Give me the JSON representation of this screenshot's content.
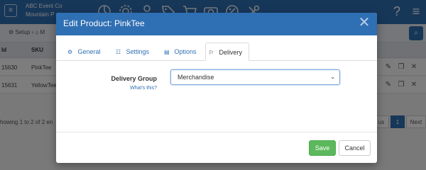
{
  "app": {
    "company_name": "ABC Event Co",
    "company_sub": "Mountain P",
    "logo_text": "≡",
    "nav_icons": [
      "analytics-icon",
      "gear-icon",
      "user-icon",
      "tags-icon",
      "cart-icon",
      "camera-icon",
      "percent-icon",
      "tools-icon"
    ],
    "help_glyph": "?",
    "menu_glyph": "≡"
  },
  "breadcrumb": {
    "setup": "⚙ Setup",
    "sep": "›",
    "next": "⌂ M"
  },
  "table": {
    "headers": {
      "id": "Id",
      "sku": "SKU"
    },
    "rows": [
      {
        "id": "15630",
        "sku": "PinkTee"
      },
      {
        "id": "15631",
        "sku": "YellowTee"
      }
    ]
  },
  "footer": {
    "showing": "howing 1 to 2 of 2 en",
    "prev": "us",
    "page": "1",
    "next": "Next"
  },
  "modal": {
    "title": "Edit Product: PinkTee",
    "close_glyph": "✕",
    "tabs": [
      {
        "label": "General",
        "icon": "⚙"
      },
      {
        "label": "Settings",
        "icon": "☷"
      },
      {
        "label": "Options",
        "icon": "▤"
      },
      {
        "label": "Delivery",
        "icon": "⚐"
      }
    ],
    "active_tab": "Delivery",
    "delivery_group_label": "Delivery Group",
    "whats_this": "What's this?",
    "delivery_group_value": "Merchandise",
    "caret": "⌄",
    "save_label": "Save",
    "cancel_label": "Cancel"
  },
  "colors": {
    "primary": "#2f6fb3",
    "save": "#5cb85c"
  }
}
